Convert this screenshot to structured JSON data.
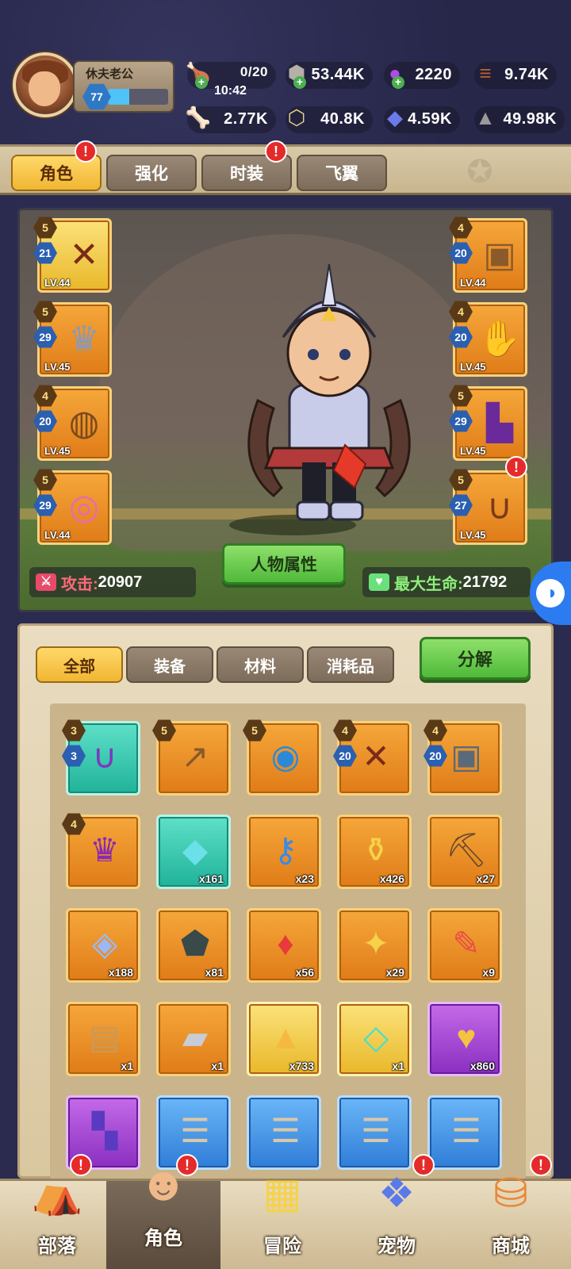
{
  "player": {
    "name": "休夫老公",
    "level": "77",
    "xp_fraction": 0.35
  },
  "resources": {
    "stamina": {
      "value": "0/20",
      "timer": "10:42"
    },
    "ore": "53.44K",
    "gem_purple": "2220",
    "wood": "9.74K",
    "bone": "2.77K",
    "coin": "40.8K",
    "crystal_blue": "4.59K",
    "stone": "49.98K"
  },
  "tabs": [
    {
      "label": "角色",
      "active": true,
      "badge": "!"
    },
    {
      "label": "强化",
      "active": false,
      "badge": ""
    },
    {
      "label": "时装",
      "active": false,
      "badge": "!"
    },
    {
      "label": "飞翼",
      "active": false,
      "badge": ""
    }
  ],
  "equipment": {
    "left": [
      {
        "star": "5",
        "enh": "21",
        "lv": "LV.44",
        "icon": "crossbow-icon"
      },
      {
        "star": "5",
        "enh": "29",
        "lv": "LV.45",
        "icon": "winged-helmet-icon"
      },
      {
        "star": "4",
        "enh": "20",
        "lv": "LV.45",
        "icon": "bag-icon"
      },
      {
        "star": "5",
        "enh": "29",
        "lv": "LV.44",
        "icon": "ring-icon"
      }
    ],
    "right": [
      {
        "star": "4",
        "enh": "20",
        "lv": "LV.44",
        "icon": "armor-icon"
      },
      {
        "star": "4",
        "enh": "20",
        "lv": "LV.45",
        "icon": "gauntlet-icon"
      },
      {
        "star": "5",
        "enh": "29",
        "lv": "LV.45",
        "icon": "boots-icon"
      },
      {
        "star": "5",
        "enh": "27",
        "lv": "LV.45",
        "icon": "necklace-icon",
        "badge": "!"
      }
    ]
  },
  "stats": {
    "attack_label": "攻击:",
    "attack_value": "20907",
    "hp_label": "最大生命:",
    "hp_value": "21792"
  },
  "attributes_button": "人物属性",
  "inventory": {
    "filters": [
      "全部",
      "装备",
      "材料",
      "消耗品"
    ],
    "active_filter": "全部",
    "decompose_label": "分解",
    "rows": [
      [
        {
          "icon": "necklace-icon",
          "bg": "teal",
          "star": "3",
          "enh": "3",
          "qty": ""
        },
        {
          "icon": "spear-icon",
          "bg": "orange",
          "star": "5",
          "enh": "",
          "qty": ""
        },
        {
          "icon": "pendant-icon",
          "bg": "orange",
          "star": "5",
          "enh": "",
          "qty": ""
        },
        {
          "icon": "crossbow-icon",
          "bg": "orange",
          "star": "4",
          "enh": "20",
          "qty": ""
        },
        {
          "icon": "shoulder-armor-icon",
          "bg": "orange",
          "star": "4",
          "enh": "20",
          "qty": ""
        }
      ],
      [
        {
          "icon": "helmet-icon",
          "bg": "orange",
          "star": "4",
          "enh": "",
          "qty": ""
        },
        {
          "icon": "crystal-icon",
          "bg": "teal",
          "star": "",
          "enh": "",
          "qty": "x161"
        },
        {
          "icon": "key-icon",
          "bg": "orange",
          "star": "",
          "enh": "",
          "qty": "x23"
        },
        {
          "icon": "potion-icon",
          "bg": "orange",
          "star": "",
          "enh": "",
          "qty": "x426"
        },
        {
          "icon": "pickaxe-icon",
          "bg": "orange",
          "star": "",
          "enh": "",
          "qty": "x27"
        }
      ],
      [
        {
          "icon": "gem-icon",
          "bg": "orange",
          "star": "",
          "enh": "",
          "qty": "x188"
        },
        {
          "icon": "rune-stone-icon",
          "bg": "orange",
          "star": "",
          "enh": "",
          "qty": "x81"
        },
        {
          "icon": "red-crystal-icon",
          "bg": "orange",
          "star": "",
          "enh": "",
          "qty": "x56"
        },
        {
          "icon": "emblem-icon",
          "bg": "orange",
          "star": "",
          "enh": "",
          "qty": "x29"
        },
        {
          "icon": "paint-tube-icon",
          "bg": "orange",
          "star": "",
          "enh": "",
          "qty": "x9"
        }
      ],
      [
        {
          "icon": "sack-icon",
          "bg": "orange",
          "star": "",
          "enh": "",
          "qty": "x1"
        },
        {
          "icon": "iron-ingot-icon",
          "bg": "orange",
          "star": "",
          "enh": "",
          "qty": "x1"
        },
        {
          "icon": "gold-pile-icon",
          "bg": "gold",
          "star": "",
          "enh": "",
          "qty": "x733"
        },
        {
          "icon": "shard-icon",
          "bg": "gold",
          "star": "",
          "enh": "",
          "qty": "x1"
        },
        {
          "icon": "heart-gem-icon",
          "bg": "purple",
          "star": "",
          "enh": "",
          "qty": "x860"
        }
      ],
      [
        {
          "icon": "purple-block-icon",
          "bg": "purple",
          "star": "",
          "enh": "",
          "qty": ""
        },
        {
          "icon": "scroll-icon",
          "bg": "blue",
          "star": "",
          "enh": "",
          "qty": ""
        },
        {
          "icon": "scroll-icon",
          "bg": "blue",
          "star": "",
          "enh": "",
          "qty": ""
        },
        {
          "icon": "scroll-icon",
          "bg": "blue",
          "star": "",
          "enh": "",
          "qty": ""
        },
        {
          "icon": "scroll-icon",
          "bg": "blue",
          "star": "",
          "enh": "",
          "qty": ""
        }
      ]
    ]
  },
  "nav": [
    {
      "label": "部落",
      "icon": "tribe-icon",
      "badge": "!",
      "active": false
    },
    {
      "label": "角色",
      "icon": "character-icon",
      "badge": "!",
      "active": true
    },
    {
      "label": "冒险",
      "icon": "map-icon",
      "badge": "",
      "active": false
    },
    {
      "label": "宠物",
      "icon": "pet-icon",
      "badge": "!",
      "active": false
    },
    {
      "label": "商城",
      "icon": "shop-icon",
      "badge": "!",
      "active": false
    }
  ],
  "colors": {
    "accent_gold": "#f0b632",
    "green_button": "#4fb93a",
    "badge_red": "#e52a2a",
    "panel_orange": "#e07c18"
  }
}
